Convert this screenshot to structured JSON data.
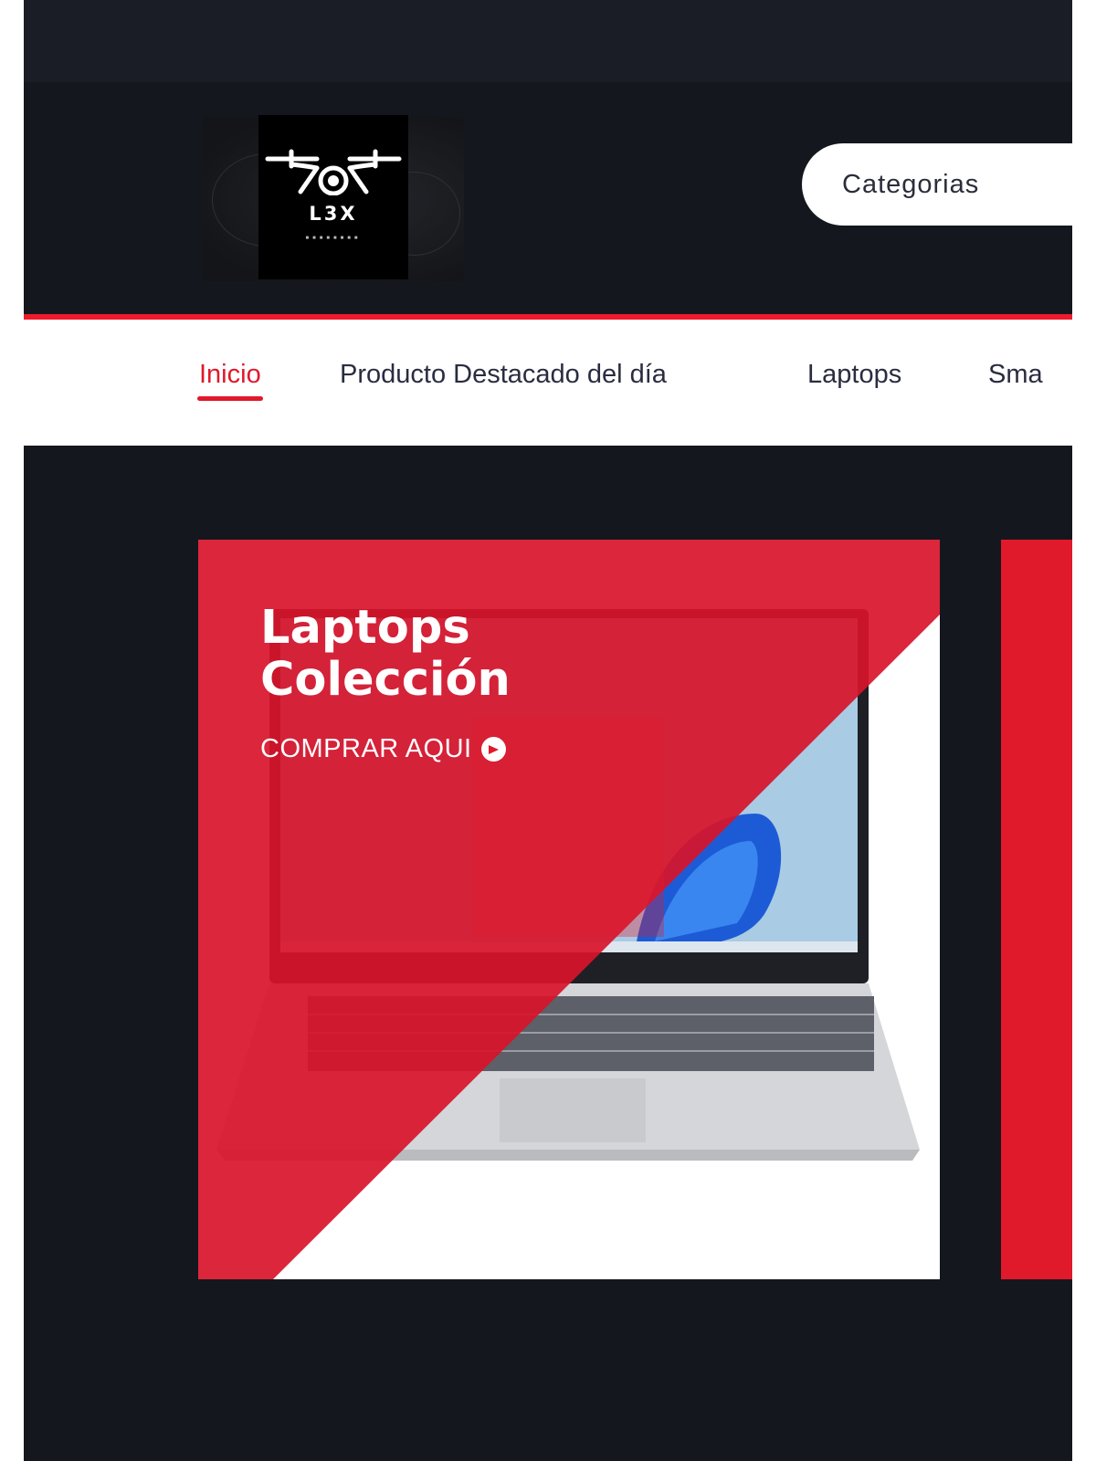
{
  "header": {
    "logo": {
      "text": "L3X",
      "dots": "■■■■■■■■"
    },
    "categories_label": "Categorias"
  },
  "nav": {
    "items": [
      {
        "label": "Inicio",
        "active": true
      },
      {
        "label": "Producto Destacado del día",
        "active": false
      },
      {
        "label": "Laptops",
        "active": false
      },
      {
        "label": "Sma",
        "active": false
      }
    ]
  },
  "hero": {
    "slide": {
      "title_line1": "Laptops",
      "title_line2": "Colección",
      "cta_label": "COMPRAR AQUI"
    }
  },
  "colors": {
    "accent": "#e0192b",
    "header_bg": "#15171e",
    "nav_text": "#2a2d40"
  },
  "icons": [
    "drone-logo-icon",
    "arrow-right-circle-icon"
  ]
}
